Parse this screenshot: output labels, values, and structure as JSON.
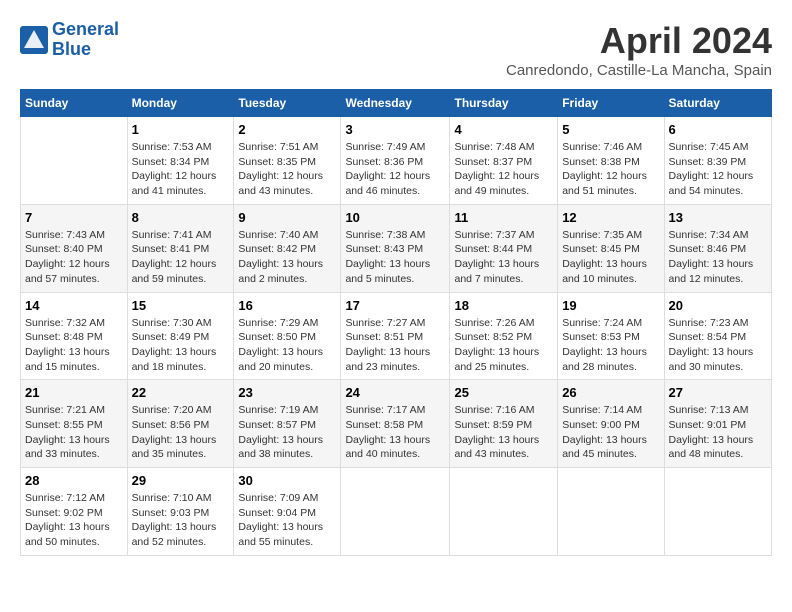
{
  "header": {
    "logo_line1": "General",
    "logo_line2": "Blue",
    "month": "April 2024",
    "location": "Canredondo, Castille-La Mancha, Spain"
  },
  "days_of_week": [
    "Sunday",
    "Monday",
    "Tuesday",
    "Wednesday",
    "Thursday",
    "Friday",
    "Saturday"
  ],
  "weeks": [
    [
      {
        "day": "",
        "info": ""
      },
      {
        "day": "1",
        "info": "Sunrise: 7:53 AM\nSunset: 8:34 PM\nDaylight: 12 hours\nand 41 minutes."
      },
      {
        "day": "2",
        "info": "Sunrise: 7:51 AM\nSunset: 8:35 PM\nDaylight: 12 hours\nand 43 minutes."
      },
      {
        "day": "3",
        "info": "Sunrise: 7:49 AM\nSunset: 8:36 PM\nDaylight: 12 hours\nand 46 minutes."
      },
      {
        "day": "4",
        "info": "Sunrise: 7:48 AM\nSunset: 8:37 PM\nDaylight: 12 hours\nand 49 minutes."
      },
      {
        "day": "5",
        "info": "Sunrise: 7:46 AM\nSunset: 8:38 PM\nDaylight: 12 hours\nand 51 minutes."
      },
      {
        "day": "6",
        "info": "Sunrise: 7:45 AM\nSunset: 8:39 PM\nDaylight: 12 hours\nand 54 minutes."
      }
    ],
    [
      {
        "day": "7",
        "info": "Sunrise: 7:43 AM\nSunset: 8:40 PM\nDaylight: 12 hours\nand 57 minutes."
      },
      {
        "day": "8",
        "info": "Sunrise: 7:41 AM\nSunset: 8:41 PM\nDaylight: 12 hours\nand 59 minutes."
      },
      {
        "day": "9",
        "info": "Sunrise: 7:40 AM\nSunset: 8:42 PM\nDaylight: 13 hours\nand 2 minutes."
      },
      {
        "day": "10",
        "info": "Sunrise: 7:38 AM\nSunset: 8:43 PM\nDaylight: 13 hours\nand 5 minutes."
      },
      {
        "day": "11",
        "info": "Sunrise: 7:37 AM\nSunset: 8:44 PM\nDaylight: 13 hours\nand 7 minutes."
      },
      {
        "day": "12",
        "info": "Sunrise: 7:35 AM\nSunset: 8:45 PM\nDaylight: 13 hours\nand 10 minutes."
      },
      {
        "day": "13",
        "info": "Sunrise: 7:34 AM\nSunset: 8:46 PM\nDaylight: 13 hours\nand 12 minutes."
      }
    ],
    [
      {
        "day": "14",
        "info": "Sunrise: 7:32 AM\nSunset: 8:48 PM\nDaylight: 13 hours\nand 15 minutes."
      },
      {
        "day": "15",
        "info": "Sunrise: 7:30 AM\nSunset: 8:49 PM\nDaylight: 13 hours\nand 18 minutes."
      },
      {
        "day": "16",
        "info": "Sunrise: 7:29 AM\nSunset: 8:50 PM\nDaylight: 13 hours\nand 20 minutes."
      },
      {
        "day": "17",
        "info": "Sunrise: 7:27 AM\nSunset: 8:51 PM\nDaylight: 13 hours\nand 23 minutes."
      },
      {
        "day": "18",
        "info": "Sunrise: 7:26 AM\nSunset: 8:52 PM\nDaylight: 13 hours\nand 25 minutes."
      },
      {
        "day": "19",
        "info": "Sunrise: 7:24 AM\nSunset: 8:53 PM\nDaylight: 13 hours\nand 28 minutes."
      },
      {
        "day": "20",
        "info": "Sunrise: 7:23 AM\nSunset: 8:54 PM\nDaylight: 13 hours\nand 30 minutes."
      }
    ],
    [
      {
        "day": "21",
        "info": "Sunrise: 7:21 AM\nSunset: 8:55 PM\nDaylight: 13 hours\nand 33 minutes."
      },
      {
        "day": "22",
        "info": "Sunrise: 7:20 AM\nSunset: 8:56 PM\nDaylight: 13 hours\nand 35 minutes."
      },
      {
        "day": "23",
        "info": "Sunrise: 7:19 AM\nSunset: 8:57 PM\nDaylight: 13 hours\nand 38 minutes."
      },
      {
        "day": "24",
        "info": "Sunrise: 7:17 AM\nSunset: 8:58 PM\nDaylight: 13 hours\nand 40 minutes."
      },
      {
        "day": "25",
        "info": "Sunrise: 7:16 AM\nSunset: 8:59 PM\nDaylight: 13 hours\nand 43 minutes."
      },
      {
        "day": "26",
        "info": "Sunrise: 7:14 AM\nSunset: 9:00 PM\nDaylight: 13 hours\nand 45 minutes."
      },
      {
        "day": "27",
        "info": "Sunrise: 7:13 AM\nSunset: 9:01 PM\nDaylight: 13 hours\nand 48 minutes."
      }
    ],
    [
      {
        "day": "28",
        "info": "Sunrise: 7:12 AM\nSunset: 9:02 PM\nDaylight: 13 hours\nand 50 minutes."
      },
      {
        "day": "29",
        "info": "Sunrise: 7:10 AM\nSunset: 9:03 PM\nDaylight: 13 hours\nand 52 minutes."
      },
      {
        "day": "30",
        "info": "Sunrise: 7:09 AM\nSunset: 9:04 PM\nDaylight: 13 hours\nand 55 minutes."
      },
      {
        "day": "",
        "info": ""
      },
      {
        "day": "",
        "info": ""
      },
      {
        "day": "",
        "info": ""
      },
      {
        "day": "",
        "info": ""
      }
    ]
  ]
}
